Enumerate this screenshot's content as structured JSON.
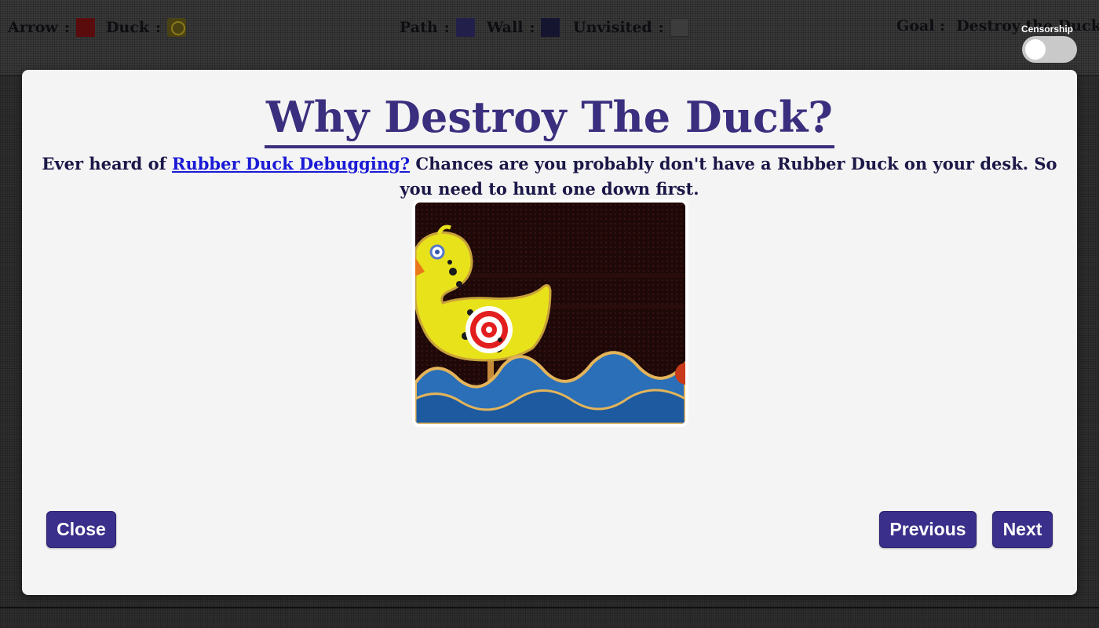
{
  "legend": {
    "items": [
      {
        "label": "Arrow",
        "separator": ":"
      },
      {
        "label": "Duck",
        "separator": ":"
      },
      {
        "label": "Path",
        "separator": ":"
      },
      {
        "label": "Wall",
        "separator": ":"
      },
      {
        "label": "Unvisited",
        "separator": ":"
      }
    ],
    "goal_label": "Goal :",
    "goal_value": "Destroy the Duck!!",
    "colors": {
      "arrow": "#5a0c0c",
      "duck": "#4a4212",
      "path": "#22204a",
      "wall": "#151530",
      "unvisited": "#3c3c3c"
    }
  },
  "censorship_toggle": {
    "label": "Censorship",
    "state": "off"
  },
  "modal": {
    "title": "Why Destroy The Duck?",
    "text_before_link": "Ever heard of ",
    "link_text": "Rubber Duck Debugging?",
    "text_after_link": " Chances are you probably don't have a Rubber Duck on your desk. So you need to hunt one down first.",
    "image_icon": "carnival-target-duck-image",
    "buttons": {
      "close": "Close",
      "previous": "Previous",
      "next": "Next"
    },
    "accent_color": "#3a2f8a"
  }
}
